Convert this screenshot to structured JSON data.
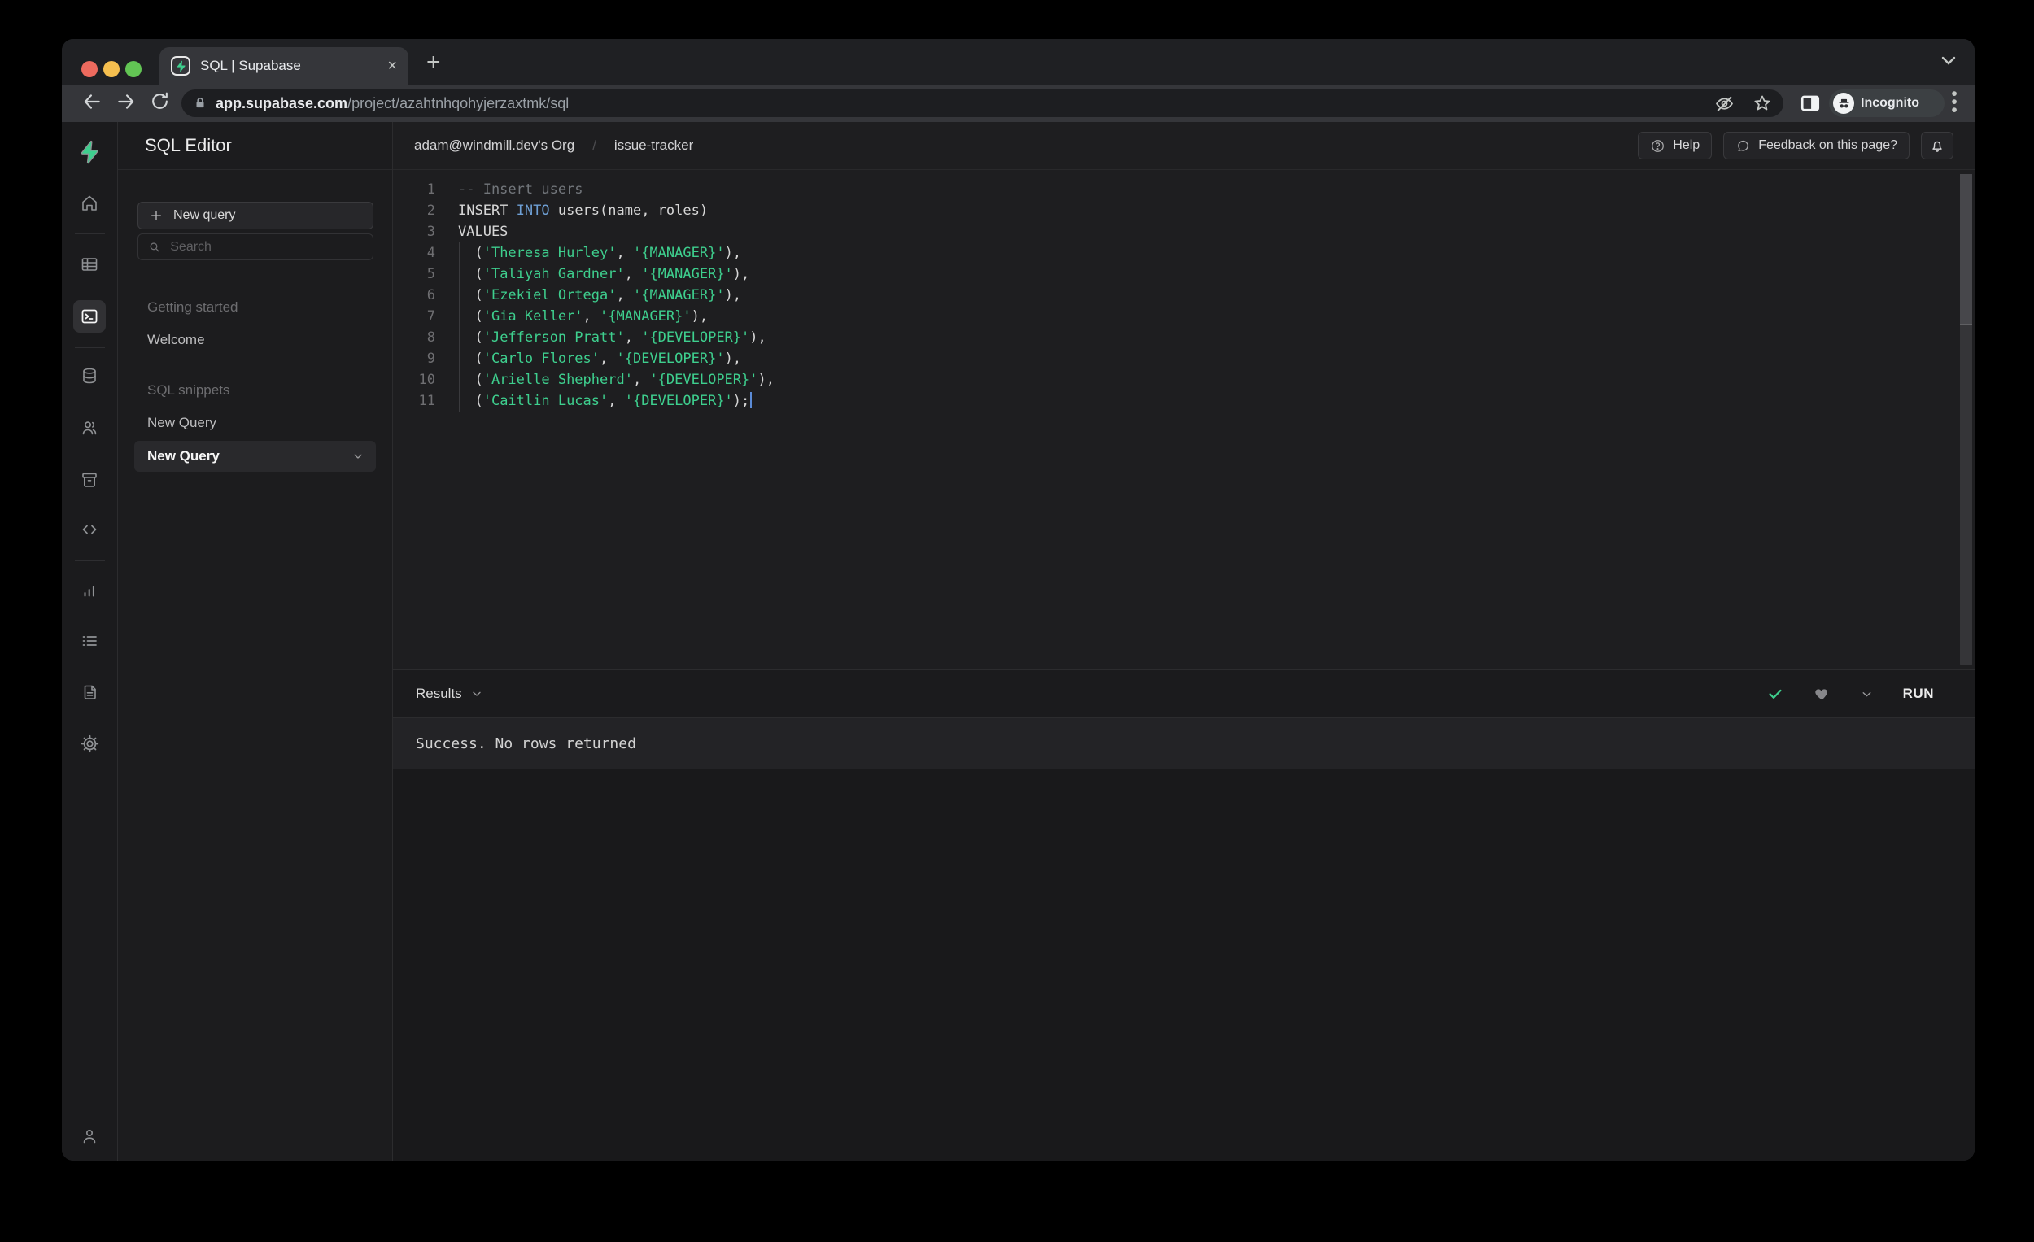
{
  "browser": {
    "tab_title": "SQL | Supabase",
    "url_host": "app.supabase.com",
    "url_path": "/project/azahtnhqohyjerzaxtmk/sql",
    "incognito_label": "Incognito"
  },
  "app_header": {
    "org": "adam@windmill.dev's Org",
    "separator": "/",
    "project": "issue-tracker",
    "help_label": "Help",
    "feedback_label": "Feedback on this page?"
  },
  "sidebar": {
    "title": "SQL Editor",
    "new_query_button": "New query",
    "search_placeholder": "Search",
    "sections": [
      {
        "heading": "Getting started",
        "items": [
          {
            "label": "Welcome",
            "selected": false
          }
        ]
      },
      {
        "heading": "SQL snippets",
        "items": [
          {
            "label": "New Query",
            "selected": false
          },
          {
            "label": "New Query",
            "selected": true
          }
        ]
      }
    ]
  },
  "editor": {
    "lines": [
      {
        "num": "1",
        "segments": [
          {
            "t": "-- Insert users",
            "c": "comment"
          }
        ]
      },
      {
        "num": "2",
        "segments": [
          {
            "t": "INSERT ",
            "c": "plain"
          },
          {
            "t": "INTO",
            "c": "keyword"
          },
          {
            "t": " users(name, roles)",
            "c": "plain"
          }
        ]
      },
      {
        "num": "3",
        "segments": [
          {
            "t": "VALUES",
            "c": "plain"
          }
        ]
      },
      {
        "num": "4",
        "segments": [
          {
            "t": "  (",
            "c": "plain"
          },
          {
            "t": "'Theresa Hurley'",
            "c": "string"
          },
          {
            "t": ", ",
            "c": "plain"
          },
          {
            "t": "'{MANAGER}'",
            "c": "string"
          },
          {
            "t": "),",
            "c": "plain"
          }
        ]
      },
      {
        "num": "5",
        "segments": [
          {
            "t": "  (",
            "c": "plain"
          },
          {
            "t": "'Taliyah Gardner'",
            "c": "string"
          },
          {
            "t": ", ",
            "c": "plain"
          },
          {
            "t": "'{MANAGER}'",
            "c": "string"
          },
          {
            "t": "),",
            "c": "plain"
          }
        ]
      },
      {
        "num": "6",
        "segments": [
          {
            "t": "  (",
            "c": "plain"
          },
          {
            "t": "'Ezekiel Ortega'",
            "c": "string"
          },
          {
            "t": ", ",
            "c": "plain"
          },
          {
            "t": "'{MANAGER}'",
            "c": "string"
          },
          {
            "t": "),",
            "c": "plain"
          }
        ]
      },
      {
        "num": "7",
        "segments": [
          {
            "t": "  (",
            "c": "plain"
          },
          {
            "t": "'Gia Keller'",
            "c": "string"
          },
          {
            "t": ", ",
            "c": "plain"
          },
          {
            "t": "'{MANAGER}'",
            "c": "string"
          },
          {
            "t": "),",
            "c": "plain"
          }
        ]
      },
      {
        "num": "8",
        "segments": [
          {
            "t": "  (",
            "c": "plain"
          },
          {
            "t": "'Jefferson Pratt'",
            "c": "string"
          },
          {
            "t": ", ",
            "c": "plain"
          },
          {
            "t": "'{DEVELOPER}'",
            "c": "string"
          },
          {
            "t": "),",
            "c": "plain"
          }
        ]
      },
      {
        "num": "9",
        "segments": [
          {
            "t": "  (",
            "c": "plain"
          },
          {
            "t": "'Carlo Flores'",
            "c": "string"
          },
          {
            "t": ", ",
            "c": "plain"
          },
          {
            "t": "'{DEVELOPER}'",
            "c": "string"
          },
          {
            "t": "),",
            "c": "plain"
          }
        ]
      },
      {
        "num": "10",
        "segments": [
          {
            "t": "  (",
            "c": "plain"
          },
          {
            "t": "'Arielle Shepherd'",
            "c": "string"
          },
          {
            "t": ", ",
            "c": "plain"
          },
          {
            "t": "'{DEVELOPER}'",
            "c": "string"
          },
          {
            "t": "),",
            "c": "plain"
          }
        ]
      },
      {
        "num": "11",
        "segments": [
          {
            "t": "  (",
            "c": "plain"
          },
          {
            "t": "'Caitlin Lucas'",
            "c": "string"
          },
          {
            "t": ", ",
            "c": "plain"
          },
          {
            "t": "'{DEVELOPER}'",
            "c": "string"
          },
          {
            "t": ");",
            "c": "plain"
          }
        ],
        "cursor": true
      }
    ]
  },
  "results": {
    "label": "Results",
    "run_label": "RUN",
    "message": "Success. No rows returned"
  },
  "colors": {
    "accent_green": "#3ecf8e",
    "keyword_blue": "#6e9fd4",
    "string_green": "#3ecf8e",
    "comment_gray": "#72767b"
  }
}
